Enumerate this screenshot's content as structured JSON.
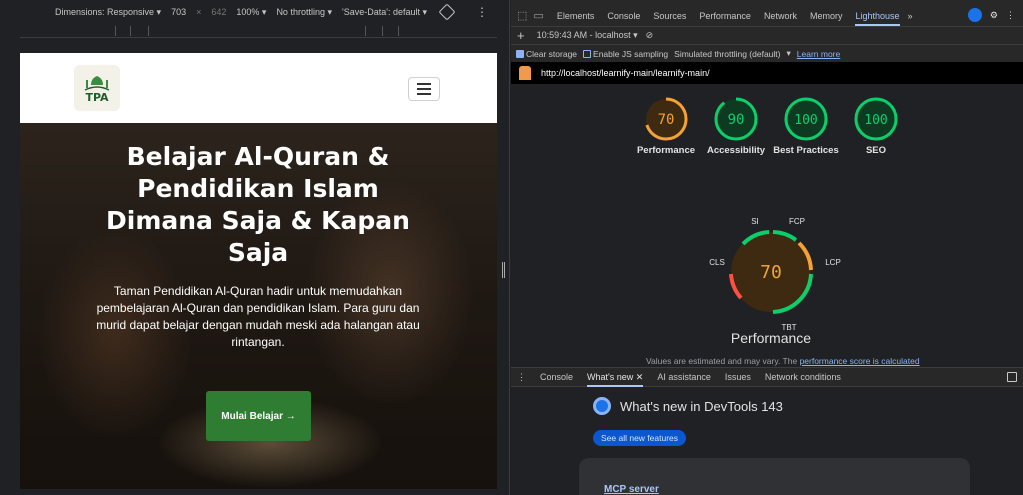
{
  "device_toolbar": {
    "dimensions": "Dimensions: Responsive ▾",
    "width": "703",
    "times": "×",
    "height": "642",
    "zoom": "100% ▾",
    "throttling": "No throttling ▾",
    "save_data": "'Save-Data': default ▾"
  },
  "site": {
    "logo_text": "TPA",
    "hero_title": "Belajar Al-Quran & Pendidikan Islam Dimana Saja & Kapan Saja",
    "hero_text": "Taman Pendidikan Al-Quran hadir untuk memudahkan pembelajaran Al-Quran dan pendidikan Islam. Para guru dan murid dapat belajar dengan mudah meski ada halangan atau rintangan.",
    "cta_label": "Mulai Belajar →"
  },
  "devtools": {
    "tabs": [
      "Elements",
      "Console",
      "Sources",
      "Performance",
      "Network",
      "Memory",
      "Lighthouse"
    ],
    "active_tab": "Lighthouse",
    "more_tabs": "»",
    "report_select": "10:59:43 AM - localhost ▾",
    "options": {
      "clear_storage": "Clear storage",
      "js_sampling": "Enable JS sampling",
      "throttling": "Simulated throttling (default)",
      "learn_more": "Learn more"
    },
    "url": "http://localhost/learnify-main/learnify-main/",
    "gauges": [
      {
        "label": "Performance",
        "score": 70,
        "color": "#f4a236"
      },
      {
        "label": "Accessibility",
        "score": 90,
        "color": "#0cce6b"
      },
      {
        "label": "Best Practices",
        "score": 100,
        "color": "#0cce6b"
      },
      {
        "label": "SEO",
        "score": 100,
        "color": "#0cce6b"
      }
    ],
    "performance": {
      "score": 70,
      "title": "Performance",
      "metrics": [
        "SI",
        "FCP",
        "LCP",
        "TBT",
        "CLS"
      ]
    },
    "footnote_prefix": "Values are estimated and may vary. The ",
    "footnote_link": "performance score is calculated",
    "drawer_tabs": [
      "Console",
      "What's new ✕",
      "AI assistance",
      "Issues",
      "Network conditions"
    ],
    "whats_new_title": "What's new in DevTools 143",
    "see_all": "See all new features",
    "card_title": "MCP server"
  }
}
